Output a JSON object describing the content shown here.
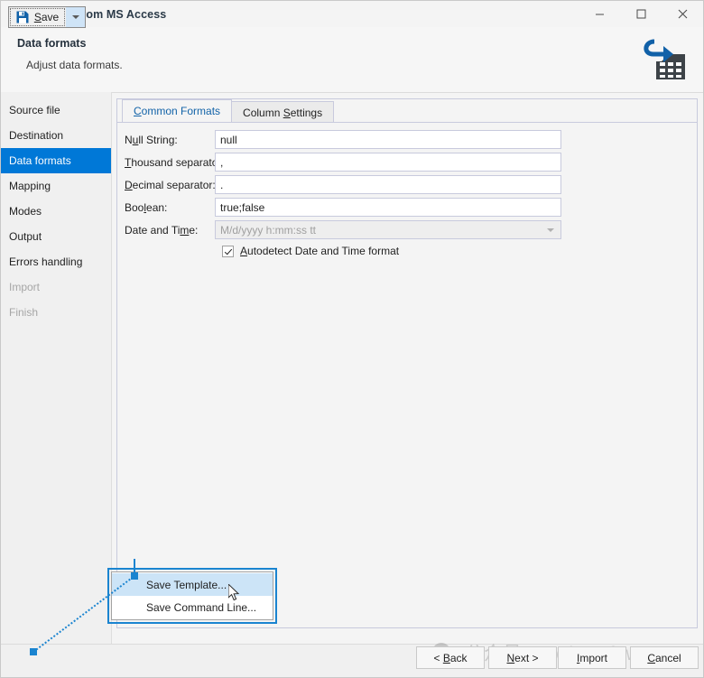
{
  "window": {
    "title": "Data Import from MS Access",
    "controls": {
      "minimize": "minimize-icon",
      "maximize": "maximize-icon",
      "close": "close-icon"
    }
  },
  "header": {
    "title": "Data formats",
    "subtitle": "Adjust data formats.",
    "icon": "data-import-icon"
  },
  "sidebar": {
    "items": [
      {
        "label": "Source file",
        "state": "normal"
      },
      {
        "label": "Destination",
        "state": "normal"
      },
      {
        "label": "Data formats",
        "state": "selected"
      },
      {
        "label": "Mapping",
        "state": "normal"
      },
      {
        "label": "Modes",
        "state": "normal"
      },
      {
        "label": "Output",
        "state": "normal"
      },
      {
        "label": "Errors handling",
        "state": "normal"
      },
      {
        "label": "Import",
        "state": "disabled"
      },
      {
        "label": "Finish",
        "state": "disabled"
      }
    ]
  },
  "tabs": [
    {
      "label": "Common Formats",
      "active": true
    },
    {
      "label": "Column Settings",
      "active": false
    }
  ],
  "form": {
    "fields": [
      {
        "label": "Null String:",
        "value": "null"
      },
      {
        "label": "Thousand separator:",
        "value": ","
      },
      {
        "label": "Decimal separator:",
        "value": "."
      },
      {
        "label": "Boolean:",
        "value": "true;false"
      }
    ],
    "datetime": {
      "label": "Date and Time:",
      "value": "M/d/yyyy h:mm:ss tt",
      "disabled": true
    },
    "autodetect": {
      "label": "Autodetect Date and Time format",
      "checked": true
    }
  },
  "context_menu": {
    "items": [
      {
        "label": "Save Template...",
        "highlighted": true
      },
      {
        "label": "Save Command Line...",
        "highlighted": false
      }
    ]
  },
  "footer": {
    "save_label": "Save",
    "save_icon": "floppy-disk-icon",
    "dropdown_icon": "chevron-down-icon",
    "buttons": [
      {
        "label": "< Back"
      },
      {
        "label": "Next >"
      },
      {
        "label": "Import"
      },
      {
        "label": "Cancel"
      }
    ]
  },
  "watermark": {
    "text": "公众号 · cogitosoftware",
    "icon": "wechat-icon"
  },
  "colors": {
    "accent": "#0078d7",
    "tab_active_text": "#1263a8",
    "annotation": "#1a84d0",
    "menu_highlight": "#cce4f7",
    "panel_border": "#c8cadd"
  }
}
